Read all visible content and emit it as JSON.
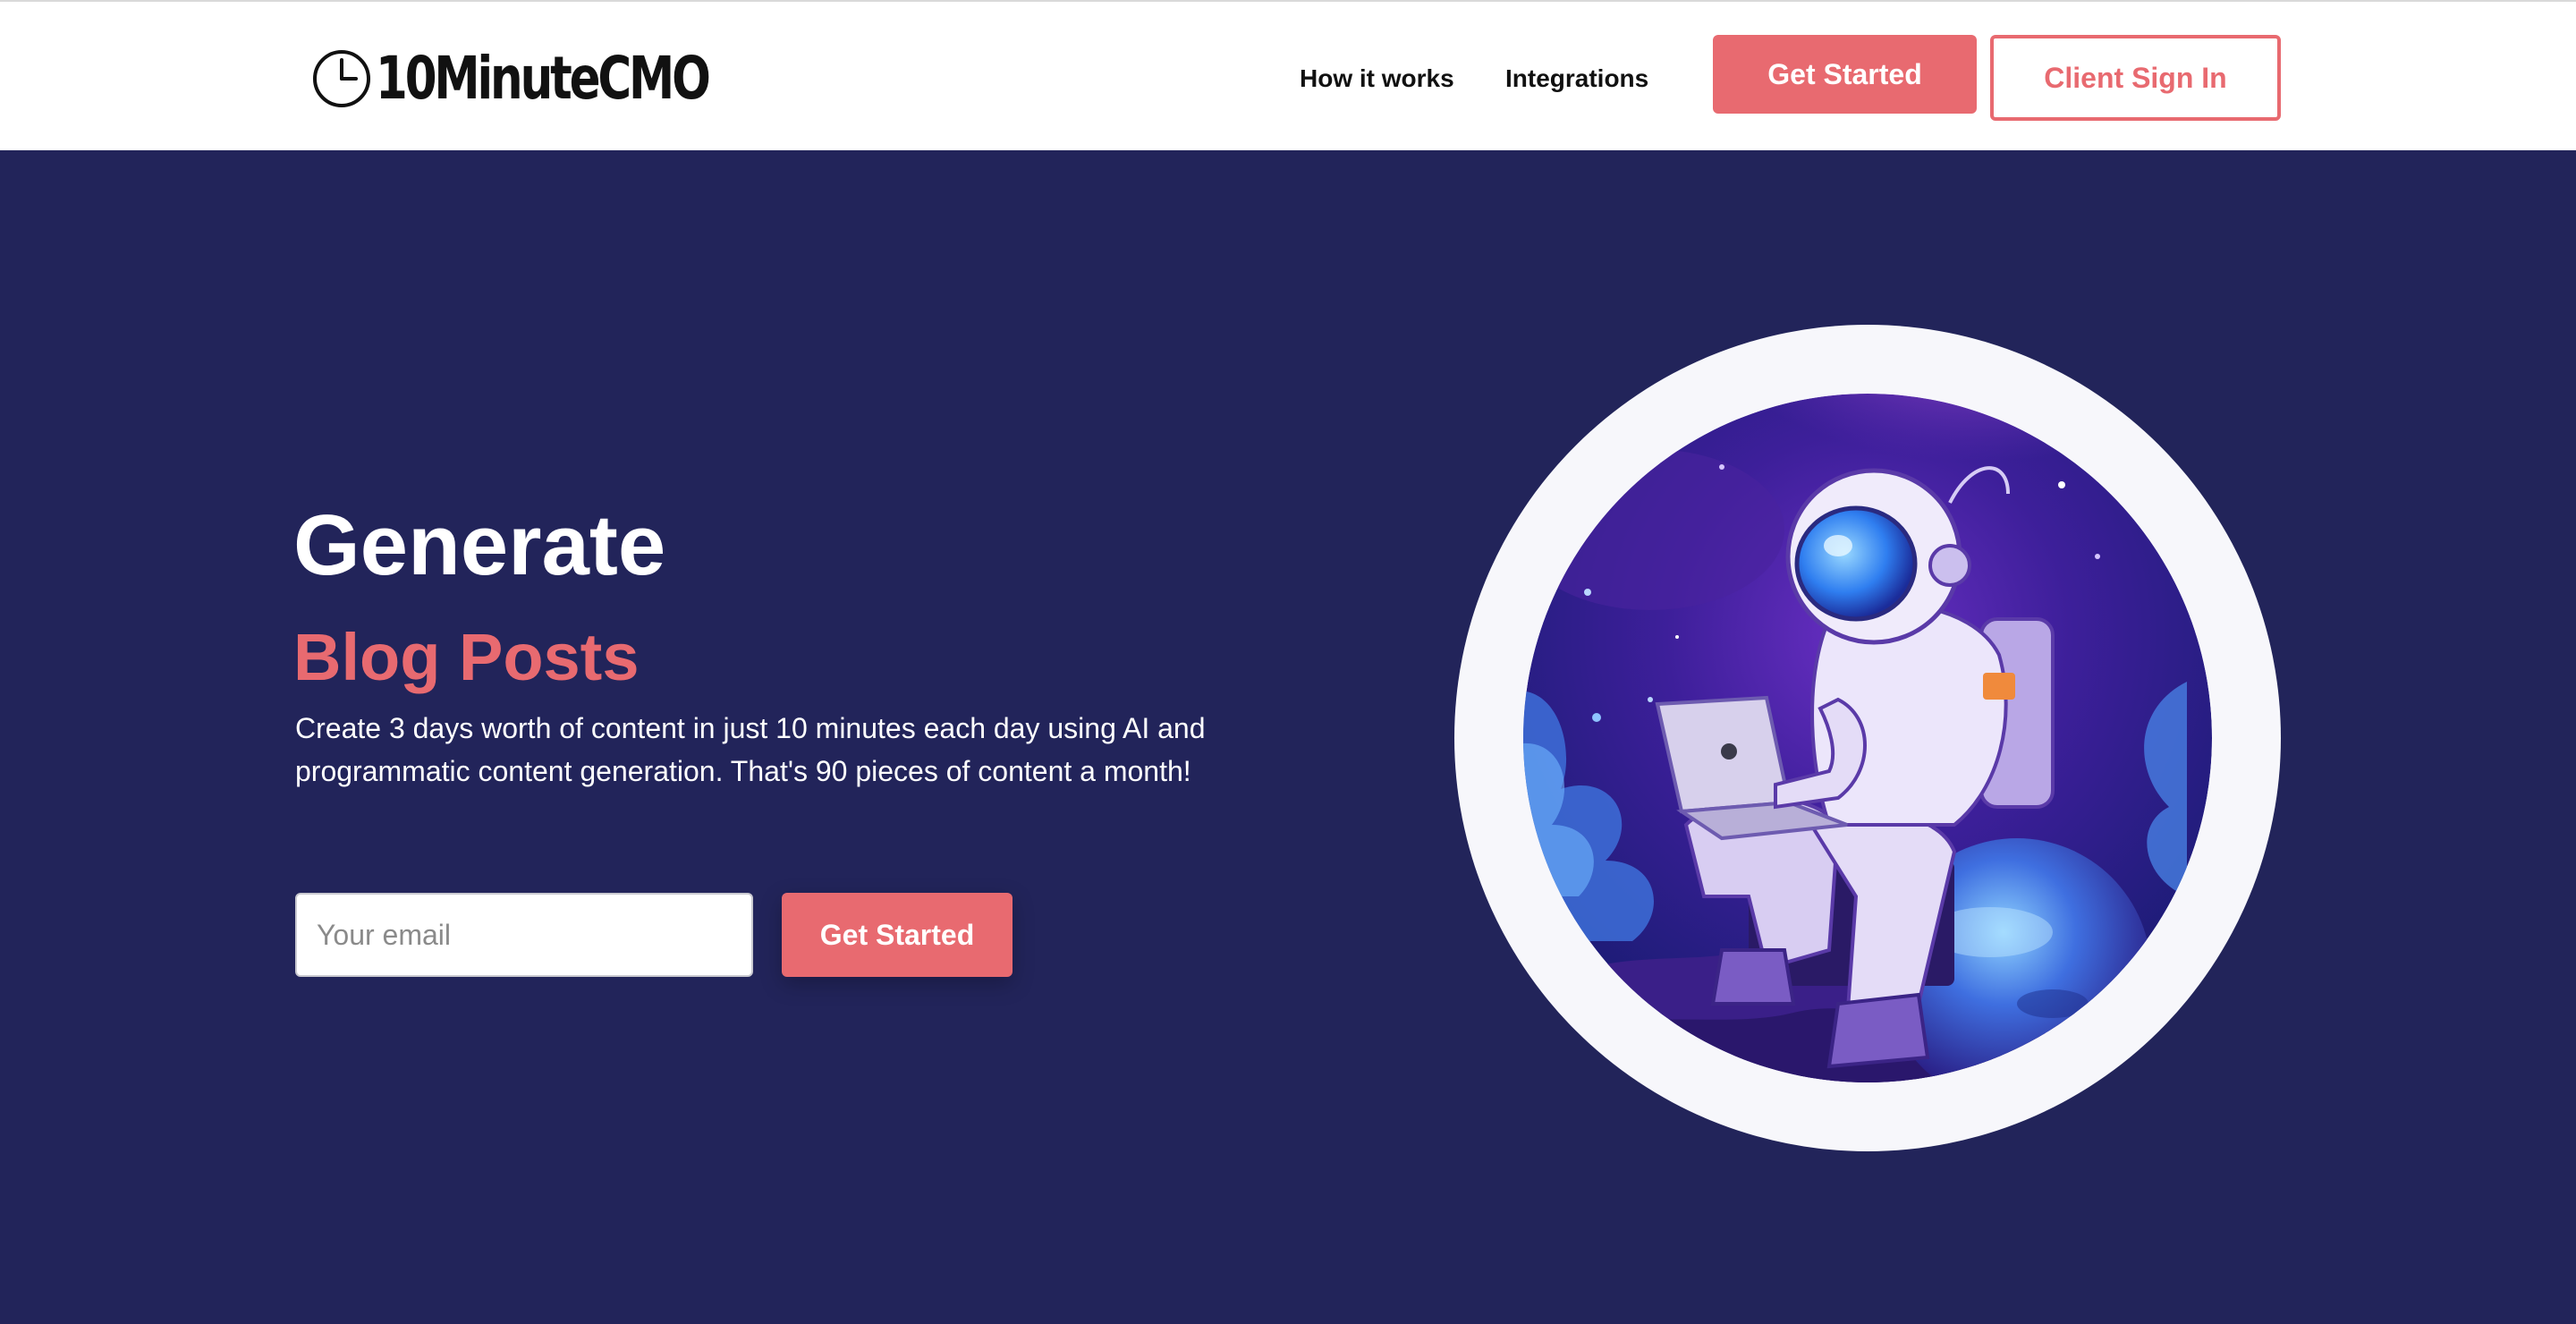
{
  "header": {
    "logo_text": "10MinuteCMO",
    "nav": {
      "how_it_works": "How it works",
      "integrations": "Integrations"
    },
    "get_started_label": "Get Started",
    "client_sign_in_label": "Client Sign In"
  },
  "hero": {
    "title": "Generate",
    "subtitle": "Blog Posts",
    "description": "Create 3 days worth of content in just 10 minutes each day using AI and programmatic content generation. That's 90 pieces of content a month!",
    "email_placeholder": "Your email",
    "cta_label": "Get Started"
  },
  "colors": {
    "brand_coral": "#e86a70",
    "navy_background": "#22245a",
    "header_background": "#ffffff"
  },
  "icons": {
    "logo": "clock-icon",
    "illustration": "astronaut-with-laptop-illustration"
  }
}
